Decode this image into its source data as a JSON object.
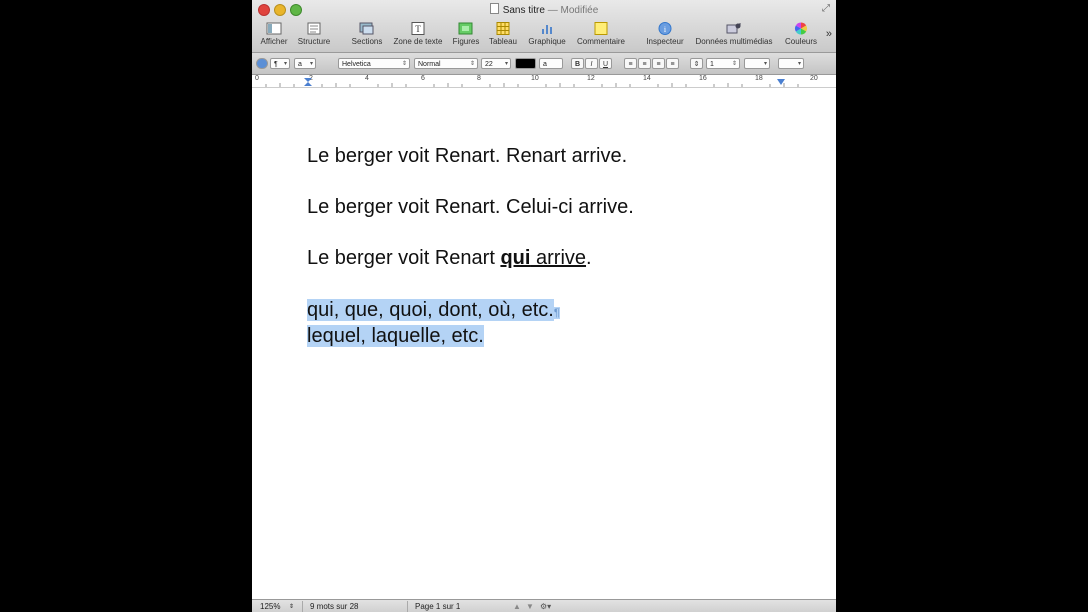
{
  "window": {
    "title": "Sans titre",
    "modified": "— Modifiée"
  },
  "toolbar": {
    "items": [
      {
        "label": "Afficher",
        "icon": "view-icon"
      },
      {
        "label": "Structure",
        "icon": "structure-icon"
      },
      {
        "label": "Sections",
        "icon": "sections-icon"
      },
      {
        "label": "Zone de texte",
        "icon": "text-box-icon"
      },
      {
        "label": "Figures",
        "icon": "shapes-icon"
      },
      {
        "label": "Tableau",
        "icon": "table-icon"
      },
      {
        "label": "Graphique",
        "icon": "chart-icon"
      },
      {
        "label": "Commentaire",
        "icon": "comment-icon"
      },
      {
        "label": "Inspecteur",
        "icon": "info-icon"
      },
      {
        "label": "Données multimédias",
        "icon": "media-icon"
      },
      {
        "label": "Couleurs",
        "icon": "color-wheel-icon"
      }
    ]
  },
  "format": {
    "paragraph_style": "¶",
    "char_style": "a",
    "font": "Helvetica",
    "typeface": "Normal",
    "size": "22",
    "text_color_char": "a",
    "bold": "B",
    "italic": "I",
    "underline": "U",
    "line_spacing": "1"
  },
  "ruler": {
    "numbers": [
      "0",
      "2",
      "4",
      "6",
      "8",
      "10",
      "12",
      "14",
      "16",
      "18",
      "20"
    ]
  },
  "document": {
    "line1": "Le berger voit Renart. Renart arrive.",
    "line2": "Le berger voit Renart. Celui-ci arrive.",
    "line3_pre": "Le berger voit Renart ",
    "line3_bold": "qui",
    "line3_under": " arrive",
    "line3_post": ".",
    "line4": "qui, que, quoi, dont, où, etc.",
    "line4_mark": "¶",
    "line5": "lequel, laquelle, etc."
  },
  "status": {
    "zoom": "125%",
    "word_count": "9 mots sur 28",
    "page": "Page 1 sur 1"
  },
  "colors": {
    "selection": "#b4d3f5"
  }
}
